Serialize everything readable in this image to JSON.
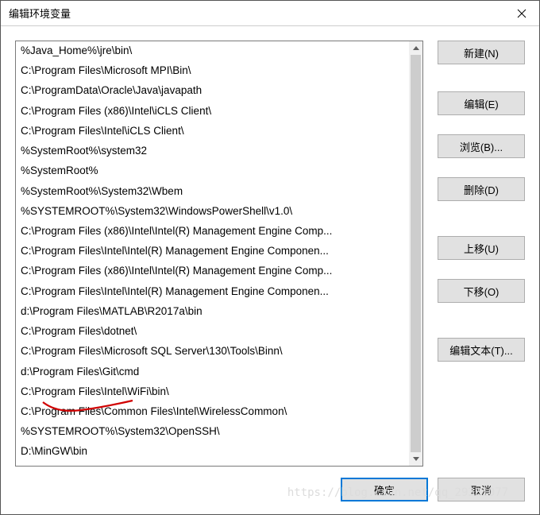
{
  "window": {
    "title": "编辑环境变量"
  },
  "list": {
    "items": [
      "%Java_Home%\\jre\\bin\\",
      "C:\\Program Files\\Microsoft MPI\\Bin\\",
      "C:\\ProgramData\\Oracle\\Java\\javapath",
      "C:\\Program Files (x86)\\Intel\\iCLS Client\\",
      "C:\\Program Files\\Intel\\iCLS Client\\",
      "%SystemRoot%\\system32",
      "%SystemRoot%",
      "%SystemRoot%\\System32\\Wbem",
      "%SYSTEMROOT%\\System32\\WindowsPowerShell\\v1.0\\",
      "C:\\Program Files (x86)\\Intel\\Intel(R) Management Engine Comp...",
      "C:\\Program Files\\Intel\\Intel(R) Management Engine Componen...",
      "C:\\Program Files (x86)\\Intel\\Intel(R) Management Engine Comp...",
      "C:\\Program Files\\Intel\\Intel(R) Management Engine Componen...",
      "d:\\Program Files\\MATLAB\\R2017a\\bin",
      "C:\\Program Files\\dotnet\\",
      "C:\\Program Files\\Microsoft SQL Server\\130\\Tools\\Binn\\",
      "d:\\Program Files\\Git\\cmd",
      "C:\\Program Files\\Intel\\WiFi\\bin\\",
      "C:\\Program Files\\Common Files\\Intel\\WirelessCommon\\",
      "%SYSTEMROOT%\\System32\\OpenSSH\\",
      "D:\\MinGW\\bin"
    ]
  },
  "buttons": {
    "new": "新建(N)",
    "edit": "编辑(E)",
    "browse": "浏览(B)...",
    "delete": "删除(D)",
    "moveUp": "上移(U)",
    "moveDown": "下移(O)",
    "editText": "编辑文本(T)...",
    "ok": "确定",
    "cancel": "取消"
  },
  "watermark": "https://blog.csdn.net/qq_29381077"
}
